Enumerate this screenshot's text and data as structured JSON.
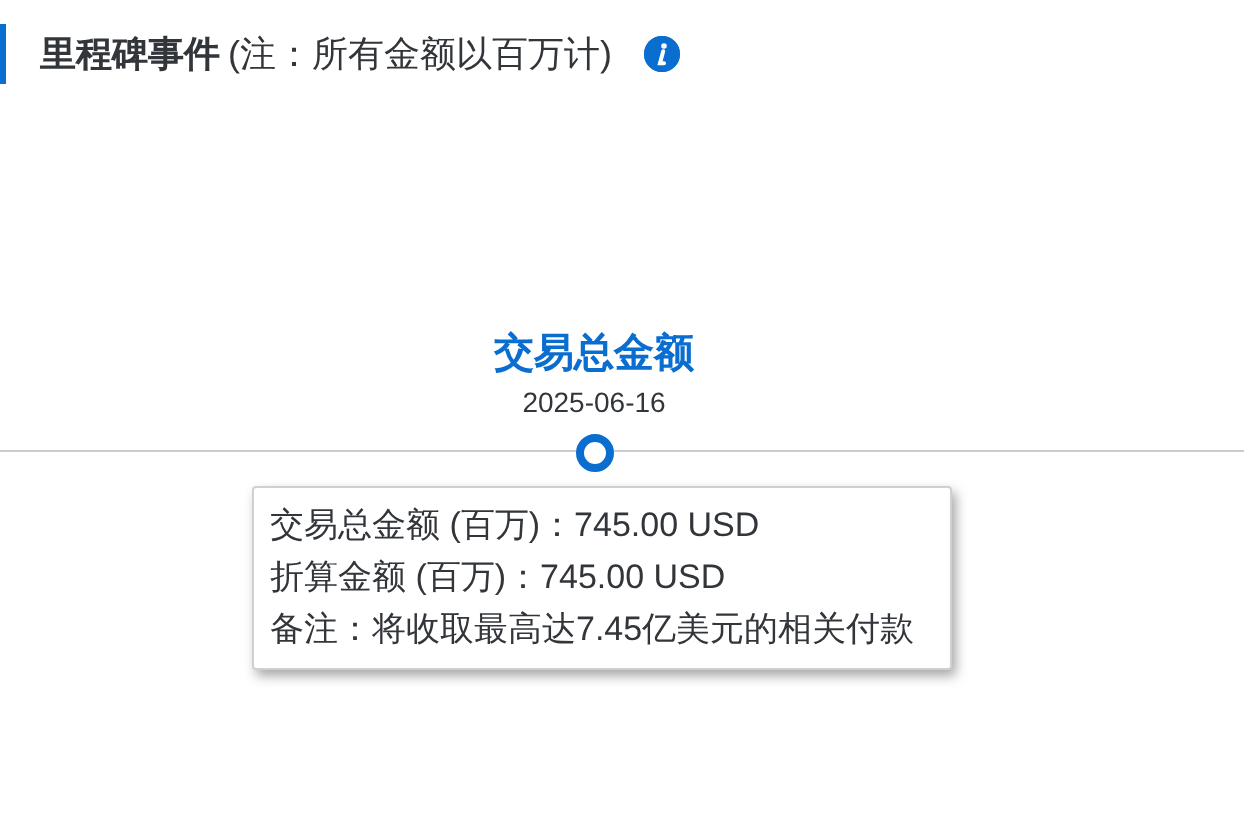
{
  "header": {
    "title": "里程碑事件",
    "note": "(注：所有金额以百万计)"
  },
  "milestones": [
    {
      "title": "交易总金额",
      "date": "2025-06-16",
      "selected": true,
      "tooltip": [
        "交易总金额 (百万)：745.00 USD",
        "折算金额 (百万)：745.00 USD",
        "备注：将收取最高达7.45亿美元的相关付款"
      ]
    }
  ]
}
